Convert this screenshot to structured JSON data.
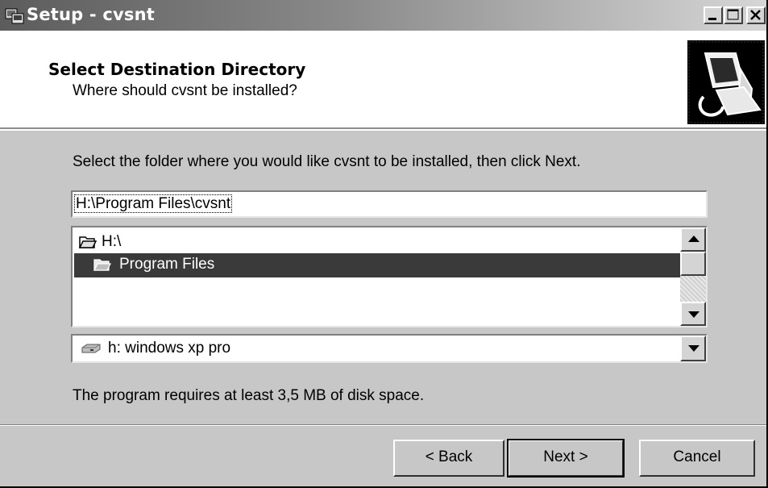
{
  "window": {
    "title": "Setup - cvsnt",
    "accent": "#5c5c5c"
  },
  "header": {
    "title": "Select Destination Directory",
    "subtitle": "Where should cvsnt be installed?",
    "image_icon": "computer-install-icon"
  },
  "body": {
    "prompt": "Select the folder where you would like cvsnt to be installed, then click Next.",
    "path_value": "H:\\Program Files\\cvsnt",
    "tree": {
      "items": [
        {
          "label": "H:\\",
          "icon": "folder-open-icon",
          "selected": false
        },
        {
          "label": "Program Files",
          "icon": "folder-open-icon",
          "selected": true
        }
      ]
    },
    "drive": {
      "label": "h: windows xp pro",
      "icon": "hard-drive-icon"
    },
    "disk_space": "The program requires at least 3,5 MB of disk space."
  },
  "buttons": {
    "back": "< Back",
    "next": "Next >",
    "cancel": "Cancel"
  }
}
